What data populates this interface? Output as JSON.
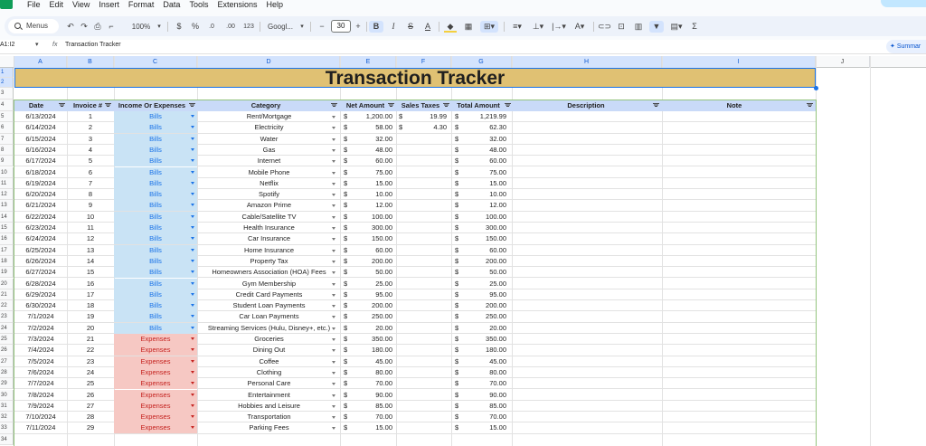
{
  "menu": [
    "File",
    "Edit",
    "View",
    "Insert",
    "Format",
    "Data",
    "Tools",
    "Extensions",
    "Help"
  ],
  "toolbar": {
    "search_label": "Menus",
    "zoom": "100%",
    "currency": "$",
    "percent": "%",
    "dec_decrease": ".0",
    "dec_increase": ".00",
    "number_format": "123",
    "font": "Googl...",
    "font_size": "30",
    "bold": "B",
    "italic": "I",
    "strike": "S",
    "text_color": "A",
    "sum": "Σ"
  },
  "formula_bar": {
    "name_box": "A1:I2",
    "fx": "fx",
    "content": "Transaction Tracker",
    "summary": "Summar"
  },
  "columns": [
    "A",
    "B",
    "C",
    "D",
    "E",
    "F",
    "G",
    "H",
    "I",
    "J"
  ],
  "rows": [
    "1",
    "2",
    "3",
    "4",
    "5",
    "6",
    "7",
    "8",
    "9",
    "10",
    "11",
    "12",
    "13",
    "14",
    "15",
    "16",
    "17",
    "18",
    "19",
    "20",
    "21",
    "22",
    "23",
    "24",
    "25",
    "26",
    "27",
    "28",
    "29",
    "30",
    "31",
    "32",
    "33",
    "34"
  ],
  "sheet": {
    "title": "Transaction Tracker",
    "headers": {
      "date": "Date",
      "invoice": "Invoice #",
      "type": "Income Or Expenses",
      "category": "Category",
      "net": "Net Amount",
      "tax": "Sales Taxes",
      "total": "Total Amount",
      "description": "Description",
      "note": "Note"
    },
    "transactions": [
      {
        "date": "6/13/2024",
        "invoice": "1",
        "type": "Bills",
        "category": "Rent/Mortgage",
        "net": "1,200.00",
        "tax": "19.99",
        "total": "1,219.99"
      },
      {
        "date": "6/14/2024",
        "invoice": "2",
        "type": "Bills",
        "category": "Electricity",
        "net": "58.00",
        "tax": "4.30",
        "total": "62.30"
      },
      {
        "date": "6/15/2024",
        "invoice": "3",
        "type": "Bills",
        "category": "Water",
        "net": "32.00",
        "tax": "",
        "total": "32.00"
      },
      {
        "date": "6/16/2024",
        "invoice": "4",
        "type": "Bills",
        "category": "Gas",
        "net": "48.00",
        "tax": "",
        "total": "48.00"
      },
      {
        "date": "6/17/2024",
        "invoice": "5",
        "type": "Bills",
        "category": "Internet",
        "net": "60.00",
        "tax": "",
        "total": "60.00"
      },
      {
        "date": "6/18/2024",
        "invoice": "6",
        "type": "Bills",
        "category": "Mobile Phone",
        "net": "75.00",
        "tax": "",
        "total": "75.00"
      },
      {
        "date": "6/19/2024",
        "invoice": "7",
        "type": "Bills",
        "category": "Netflix",
        "net": "15.00",
        "tax": "",
        "total": "15.00"
      },
      {
        "date": "6/20/2024",
        "invoice": "8",
        "type": "Bills",
        "category": "Spotify",
        "net": "10.00",
        "tax": "",
        "total": "10.00"
      },
      {
        "date": "6/21/2024",
        "invoice": "9",
        "type": "Bills",
        "category": "Amazon Prime",
        "net": "12.00",
        "tax": "",
        "total": "12.00"
      },
      {
        "date": "6/22/2024",
        "invoice": "10",
        "type": "Bills",
        "category": "Cable/Satellite TV",
        "net": "100.00",
        "tax": "",
        "total": "100.00"
      },
      {
        "date": "6/23/2024",
        "invoice": "11",
        "type": "Bills",
        "category": "Health Insurance",
        "net": "300.00",
        "tax": "",
        "total": "300.00"
      },
      {
        "date": "6/24/2024",
        "invoice": "12",
        "type": "Bills",
        "category": "Car Insurance",
        "net": "150.00",
        "tax": "",
        "total": "150.00"
      },
      {
        "date": "6/25/2024",
        "invoice": "13",
        "type": "Bills",
        "category": "Home Insurance",
        "net": "60.00",
        "tax": "",
        "total": "60.00"
      },
      {
        "date": "6/26/2024",
        "invoice": "14",
        "type": "Bills",
        "category": "Property Tax",
        "net": "200.00",
        "tax": "",
        "total": "200.00"
      },
      {
        "date": "6/27/2024",
        "invoice": "15",
        "type": "Bills",
        "category": "Homeowners Association (HOA) Fees",
        "net": "50.00",
        "tax": "",
        "total": "50.00"
      },
      {
        "date": "6/28/2024",
        "invoice": "16",
        "type": "Bills",
        "category": "Gym Membership",
        "net": "25.00",
        "tax": "",
        "total": "25.00"
      },
      {
        "date": "6/29/2024",
        "invoice": "17",
        "type": "Bills",
        "category": "Credit Card Payments",
        "net": "95.00",
        "tax": "",
        "total": "95.00"
      },
      {
        "date": "6/30/2024",
        "invoice": "18",
        "type": "Bills",
        "category": "Student Loan Payments",
        "net": "200.00",
        "tax": "",
        "total": "200.00"
      },
      {
        "date": "7/1/2024",
        "invoice": "19",
        "type": "Bills",
        "category": "Car Loan Payments",
        "net": "250.00",
        "tax": "",
        "total": "250.00"
      },
      {
        "date": "7/2/2024",
        "invoice": "20",
        "type": "Bills",
        "category": "Streaming Services (Hulu, Disney+, etc.)",
        "net": "20.00",
        "tax": "",
        "total": "20.00"
      },
      {
        "date": "7/3/2024",
        "invoice": "21",
        "type": "Expenses",
        "category": "Groceries",
        "net": "350.00",
        "tax": "",
        "total": "350.00"
      },
      {
        "date": "7/4/2024",
        "invoice": "22",
        "type": "Expenses",
        "category": "Dining Out",
        "net": "180.00",
        "tax": "",
        "total": "180.00"
      },
      {
        "date": "7/5/2024",
        "invoice": "23",
        "type": "Expenses",
        "category": "Coffee",
        "net": "45.00",
        "tax": "",
        "total": "45.00"
      },
      {
        "date": "7/6/2024",
        "invoice": "24",
        "type": "Expenses",
        "category": "Clothing",
        "net": "80.00",
        "tax": "",
        "total": "80.00"
      },
      {
        "date": "7/7/2024",
        "invoice": "25",
        "type": "Expenses",
        "category": "Personal Care",
        "net": "70.00",
        "tax": "",
        "total": "70.00"
      },
      {
        "date": "7/8/2024",
        "invoice": "26",
        "type": "Expenses",
        "category": "Entertainment",
        "net": "90.00",
        "tax": "",
        "total": "90.00"
      },
      {
        "date": "7/9/2024",
        "invoice": "27",
        "type": "Expenses",
        "category": "Hobbies and Leisure",
        "net": "85.00",
        "tax": "",
        "total": "85.00"
      },
      {
        "date": "7/10/2024",
        "invoice": "28",
        "type": "Expenses",
        "category": "Transportation",
        "net": "70.00",
        "tax": "",
        "total": "70.00"
      },
      {
        "date": "7/11/2024",
        "invoice": "29",
        "type": "Expenses",
        "category": "Parking Fees",
        "net": "15.00",
        "tax": "",
        "total": "15.00"
      }
    ],
    "currency_symbol": "$"
  },
  "colors": {
    "title_bg": "#e0c173",
    "header_bg": "#c9daf8",
    "bills_bg": "#c9e3f5",
    "expenses_bg": "#f6c8c3",
    "accent": "#1a73e8"
  }
}
